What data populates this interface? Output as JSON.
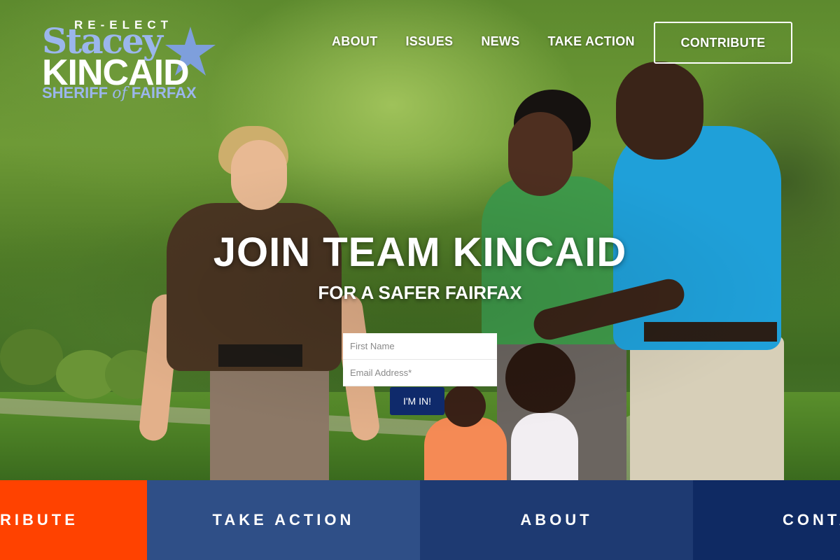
{
  "logo": {
    "reelect": "RE-ELECT",
    "first_name": "Stacey",
    "last_name": "KINCAID",
    "office": "SHERIFF",
    "of": "of",
    "county": "FAIRFAX",
    "star_icon": "star-icon"
  },
  "nav": {
    "items": [
      "ABOUT",
      "ISSUES",
      "NEWS",
      "TAKE ACTION"
    ],
    "contribute_label": "CONTRIBUTE"
  },
  "hero": {
    "headline": "JOIN TEAM KINCAID",
    "subhead": "FOR A SAFER FAIRFAX"
  },
  "signup": {
    "first_name_placeholder": "First Name",
    "first_name_value": "",
    "email_placeholder": "Email Address*",
    "email_value": "",
    "submit_label": "I'M IN!"
  },
  "bottombar": {
    "items": [
      {
        "label": "CONTRIBUTE",
        "visible_text": "RIBUTE",
        "color": "#ff4200"
      },
      {
        "label": "TAKE ACTION",
        "visible_text": "TAKE ACTION",
        "color": "#2f4f87"
      },
      {
        "label": "ABOUT",
        "visible_text": "ABOUT",
        "color": "#1e3a72"
      },
      {
        "label": "CONTACT",
        "visible_text": "CONTA",
        "color": "#0f2a63"
      }
    ]
  },
  "colors": {
    "logo_blue": "#9bb6ec",
    "submit_navy": "#0f2a6b"
  }
}
